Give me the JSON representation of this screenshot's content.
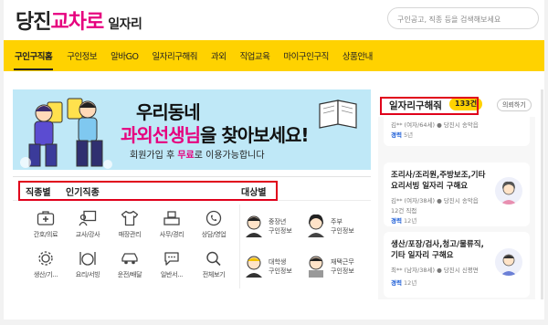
{
  "header": {
    "logo_part1": "당진",
    "logo_part2": "교차로",
    "logo_part3": "일자리",
    "search_placeholder": "구인공고, 직종 등을 검색해보세요"
  },
  "nav": {
    "items": [
      "구인구직홈",
      "구인정보",
      "알바GO",
      "일자리구해줘",
      "과외",
      "직업교육",
      "마이구인구직",
      "상품안내"
    ],
    "active_index": 0
  },
  "banner": {
    "line1": "우리동네",
    "line2_highlight": "과외선생님",
    "line2_rest": "을 찾아보세요!",
    "sub_pre": "회원가입 후 ",
    "sub_accent": "무료",
    "sub_post": "로 이용가능합니다"
  },
  "categories": {
    "tab1": "직종별",
    "tab2": "인기직종",
    "tab3": "대상별",
    "items": [
      {
        "label": "간호/의료",
        "icon": "first-aid-icon"
      },
      {
        "label": "교사/강사",
        "icon": "teacher-icon"
      },
      {
        "label": "매장관리",
        "icon": "shirt-icon"
      },
      {
        "label": "사무/경리",
        "icon": "office-icon"
      },
      {
        "label": "상담/영업",
        "icon": "phone-icon"
      },
      {
        "label": "생산/기...",
        "icon": "gear-icon"
      },
      {
        "label": "요리/서빙",
        "icon": "cooking-icon"
      },
      {
        "label": "운전/배달",
        "icon": "car-icon"
      },
      {
        "label": "일반서...",
        "icon": "chat-icon"
      },
      {
        "label": "전체보기",
        "icon": "search-icon"
      }
    ],
    "targets": [
      {
        "line1": "중장년",
        "line2": "구인정보",
        "icon": "middle-aged-icon"
      },
      {
        "line1": "주부",
        "line2": "구인정보",
        "icon": "homemaker-icon"
      },
      {
        "line1": "대학생",
        "line2": "구인정보",
        "icon": "student-icon"
      },
      {
        "line1": "재택근무",
        "line2": "구인정보",
        "icon": "remote-work-icon"
      }
    ]
  },
  "side": {
    "title": "일자리구해줘",
    "count": "133건",
    "more": "의뢰하기",
    "card0": {
      "meta": "김** (여자/64세) ● 당진시 송악읍",
      "exp_label": "경력",
      "exp_value": "5년"
    },
    "card1": {
      "title1": "조리사/조리원,주방보조,기타",
      "title2": "요리서빙 일자리 구해요",
      "meta": "김** (여자/38세) ● 당진시 송악읍",
      "count_line": "12건 직접",
      "exp_label": "경력",
      "exp_value": "12년"
    },
    "card2": {
      "title1": "생산/포장/검사,청고/물류직,",
      "title2": "기타 일자리 구해요",
      "meta": "최** (남자/38세) ● 당진시 신평면",
      "exp_label": "경력",
      "exp_value": "12년"
    }
  },
  "colors": {
    "brand": "#ffd200",
    "accent": "#e6007e",
    "annotation": "#e0001b",
    "banner_bg": "#bfe8f7"
  }
}
